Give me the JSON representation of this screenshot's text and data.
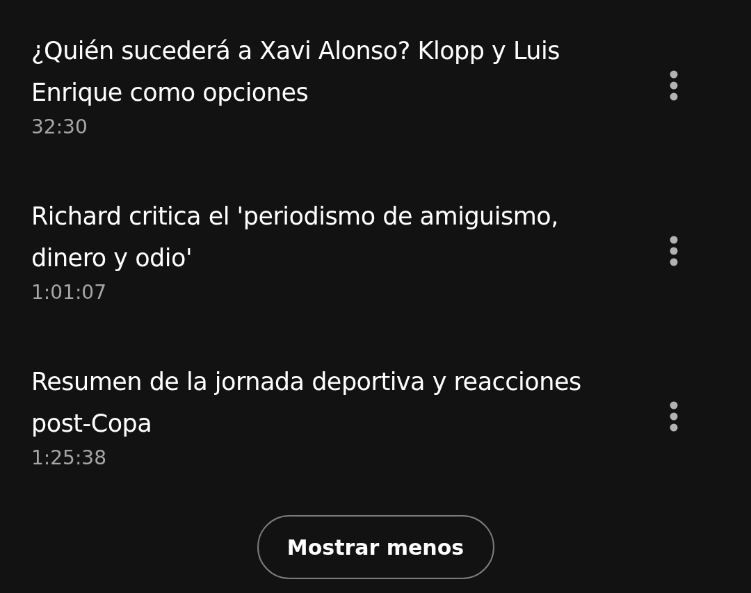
{
  "episodes": [
    {
      "title": "¿Quién sucederá a Xavi Alonso? Klopp y Luis Enrique como opciones",
      "duration": "32:30"
    },
    {
      "title": "Richard critica el 'periodismo de amiguismo, dinero y odio'",
      "duration": "1:01:07"
    },
    {
      "title": "Resumen de la jornada deportiva y reacciones post-Copa",
      "duration": "1:25:38"
    }
  ],
  "show_less_button": {
    "label": "Mostrar menos"
  }
}
